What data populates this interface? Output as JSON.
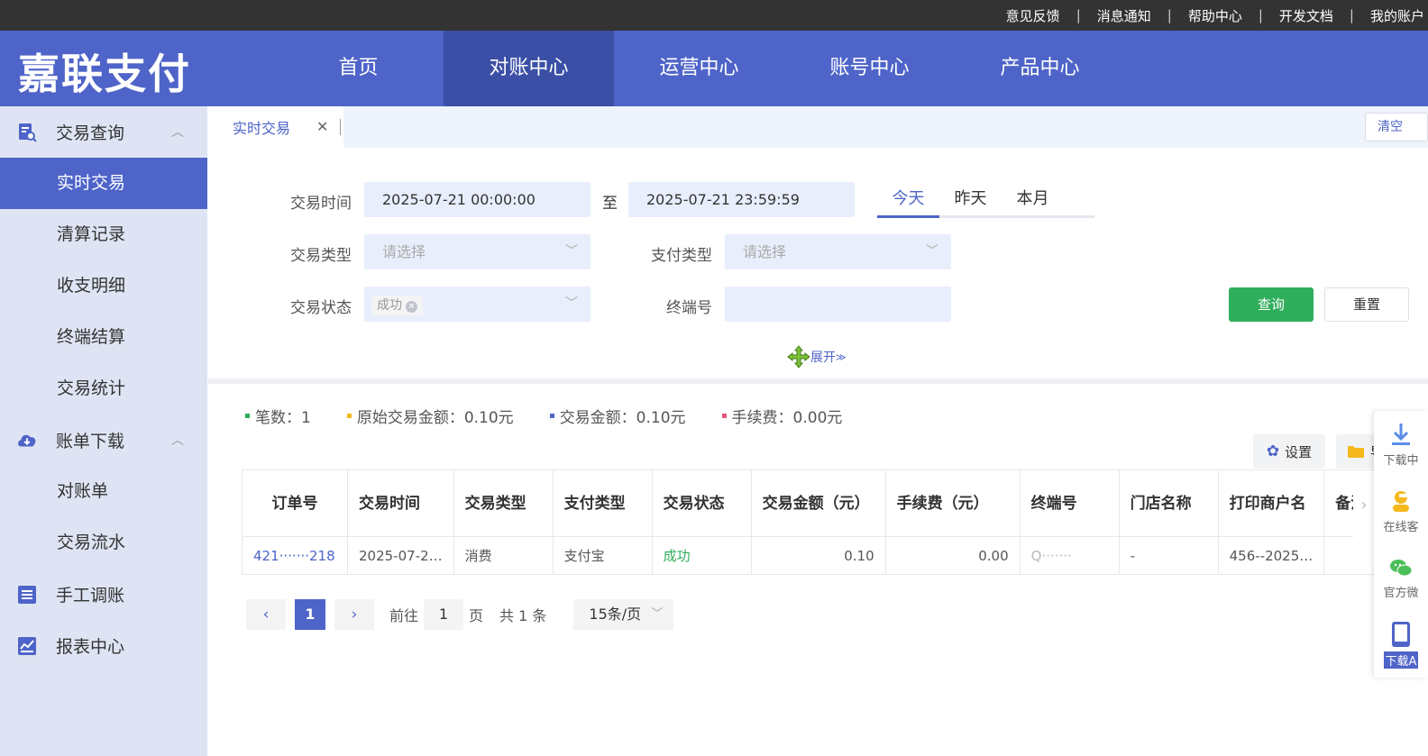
{
  "topbar": {
    "links": [
      "意见反馈",
      "消息通知",
      "帮助中心",
      "开发文档",
      "我的账户"
    ]
  },
  "header": {
    "logo": "嘉联支付",
    "nav": [
      "首页",
      "对账中心",
      "运营中心",
      "账号中心",
      "产品中心"
    ],
    "active_nav": "对账中心"
  },
  "sidebar": {
    "groups": [
      {
        "label": "交易查询",
        "icon": "search-doc-icon",
        "items": [
          "实时交易",
          "清算记录",
          "收支明细",
          "终端结算",
          "交易统计"
        ]
      },
      {
        "label": "账单下载",
        "icon": "cloud-download-icon",
        "items": [
          "对账单",
          "交易流水"
        ]
      },
      {
        "label": "手工调账",
        "icon": "list-icon",
        "items": []
      },
      {
        "label": "报表中心",
        "icon": "chart-icon",
        "items": []
      }
    ],
    "active_item": "实时交易"
  },
  "tabs": {
    "current": "实时交易",
    "clear_label": "清空"
  },
  "filters": {
    "time_label": "交易时间",
    "start_time": "2025-07-21 00:00:00",
    "to_label": "至",
    "end_time": "2025-07-21 23:59:59",
    "quick": [
      "今天",
      "昨天",
      "本月"
    ],
    "quick_active": "今天",
    "type_label": "交易类型",
    "type_placeholder": "请选择",
    "pay_type_label": "支付类型",
    "pay_type_placeholder": "请选择",
    "status_label": "交易状态",
    "status_tag": "成功",
    "terminal_label": "终端号",
    "terminal_value": "",
    "query_label": "查询",
    "reset_label": "重置",
    "expand_label": "展开"
  },
  "stats": [
    {
      "label": "笔数：1",
      "color": "#2fae5b"
    },
    {
      "label": "原始交易金额：0.10元",
      "color": "#f5b81d"
    },
    {
      "label": "交易金额：0.10元",
      "color": "#4e64c8"
    },
    {
      "label": "手续费：0.00元",
      "color": "#e8537a"
    }
  ],
  "toolbar": {
    "settings_label": "设置",
    "second_label": "导"
  },
  "table": {
    "headers": [
      "订单号",
      "交易时间",
      "交易类型",
      "支付类型",
      "交易状态",
      "交易金额（元）",
      "手续费（元）",
      "终端号",
      "门店名称",
      "打印商户名",
      "备注"
    ],
    "rows": [
      [
        "421·······218",
        "2025-07-2…",
        "消费",
        "支付宝",
        "成功",
        "0.10",
        "0.00",
        "Q·······",
        "-",
        "456--2025…",
        ""
      ]
    ]
  },
  "pager": {
    "current_page": "1",
    "goto_label": "前往",
    "goto_value": "1",
    "page_unit": "页",
    "total_label": "共 1 条",
    "page_size": "15条/页"
  },
  "float_panel": [
    "下载中",
    "在线客",
    "官方微",
    "下载A"
  ]
}
